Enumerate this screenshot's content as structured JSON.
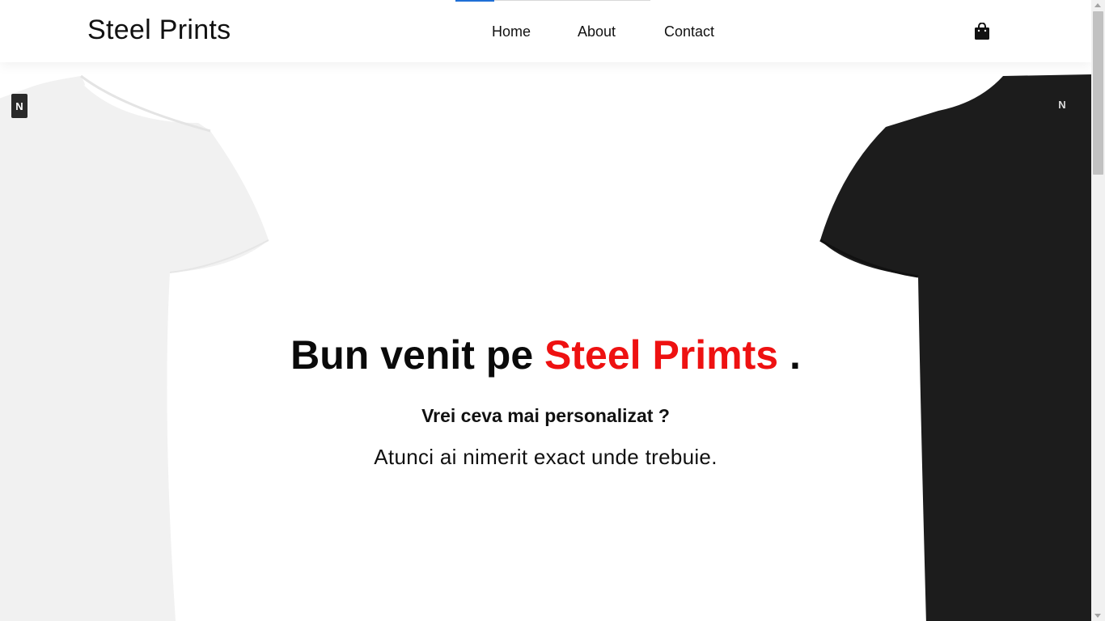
{
  "navbar": {
    "brand": "Steel Prints",
    "links": [
      {
        "label": "Home"
      },
      {
        "label": "About"
      },
      {
        "label": "Contact"
      }
    ],
    "cart_icon": "shopping-bag-icon",
    "scroll_progress": 0.2
  },
  "hero": {
    "title_prefix": "Bun venit pe ",
    "title_accent": "Steel Primts",
    "title_suffix": " .",
    "subtitle": "Vrei ceva mai personalizat ?",
    "text": "Atunci ai nimerit exact unde trebuie."
  },
  "images": {
    "left_shirt": {
      "color": "#f1f1f1",
      "label_icon": "brand-tag-icon"
    },
    "right_shirt": {
      "color": "#1c1c1c",
      "label_icon": "brand-tag-icon"
    }
  },
  "colors": {
    "accent": "#ee1111",
    "progress": "#1f6fd6"
  }
}
